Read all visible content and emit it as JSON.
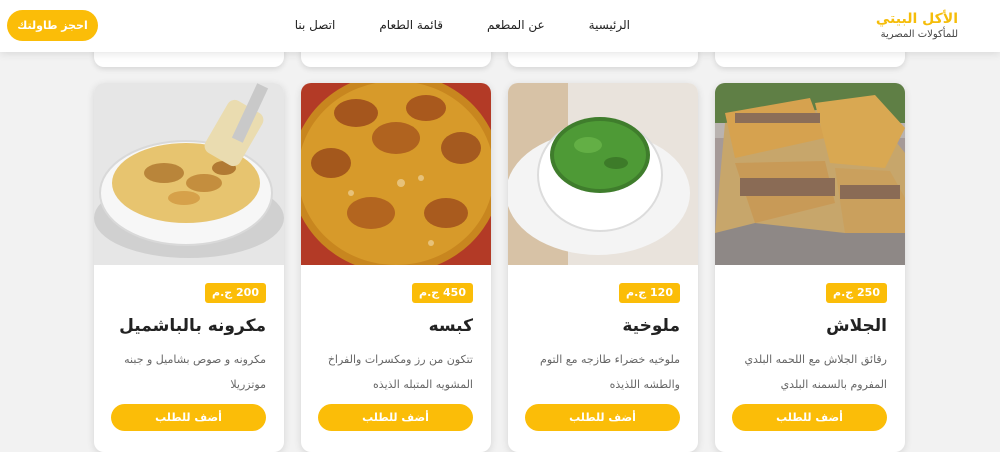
{
  "header": {
    "brand_name": "الأكل البيتي",
    "brand_tagline": "للمأكولات المصرية",
    "nav": [
      "الرئيسية",
      "عن المطعم",
      "قائمة الطعام",
      "اتصل بنا"
    ],
    "reserve_label": "احجز طاولتك"
  },
  "menu": {
    "items": [
      {
        "title": "الجلاش",
        "price": "250 ج.م",
        "description": "رقائق الجلاش مع اللحمه البلدي المفروم بالسمنه البلدي",
        "button": "أضف للطلب"
      },
      {
        "title": "ملوخية",
        "price": "120 ج.م",
        "description": "ملوخيه خضراء طازجه مع التوم والطشه اللذيذه",
        "button": "أضف للطلب"
      },
      {
        "title": "كبسه",
        "price": "450 ج.م",
        "description": "تتكون من رز ومكسرات والفراخ المشويه المتبله الذيذه",
        "button": "أضف للطلب"
      },
      {
        "title": "مكرونه بالباشميل",
        "price": "200 ج.م",
        "description": "مكرونه و صوص بشاميل و جبنه موتزريلا",
        "button": "أضف للطلب"
      }
    ]
  },
  "colors": {
    "accent": "#fbbd08",
    "brand": "#f5bd0a",
    "background": "#f2f2f2"
  }
}
